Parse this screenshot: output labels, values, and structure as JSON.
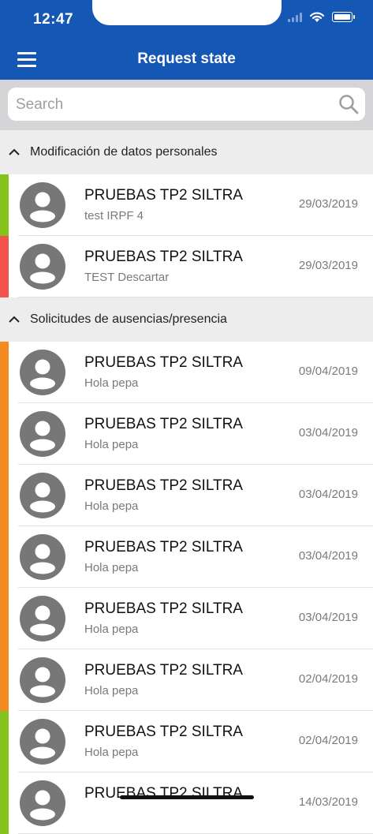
{
  "status_bar": {
    "time": "12:47"
  },
  "header": {
    "title": "Request state"
  },
  "search": {
    "placeholder": "Search"
  },
  "colors": {
    "header": "#1557b5",
    "green": "#85c31c",
    "red": "#f4524a",
    "orange": "#f38b22"
  },
  "sections": [
    {
      "title": "Modificación de datos personales",
      "items": [
        {
          "name": "PRUEBAS TP2 SILTRA",
          "subtitle": "test IRPF 4",
          "date": "29/03/2019",
          "status": "green"
        },
        {
          "name": "PRUEBAS TP2 SILTRA",
          "subtitle": "TEST Descartar",
          "date": "29/03/2019",
          "status": "red"
        }
      ]
    },
    {
      "title": "Solicitudes de ausencias/presencia",
      "items": [
        {
          "name": "PRUEBAS TP2 SILTRA",
          "subtitle": "Hola pepa",
          "date": "09/04/2019",
          "status": "orange"
        },
        {
          "name": "PRUEBAS TP2 SILTRA",
          "subtitle": "Hola pepa",
          "date": "03/04/2019",
          "status": "orange"
        },
        {
          "name": "PRUEBAS TP2 SILTRA",
          "subtitle": "Hola pepa",
          "date": "03/04/2019",
          "status": "orange"
        },
        {
          "name": "PRUEBAS TP2 SILTRA",
          "subtitle": "Hola pepa",
          "date": "03/04/2019",
          "status": "orange"
        },
        {
          "name": "PRUEBAS TP2 SILTRA",
          "subtitle": "Hola pepa",
          "date": "03/04/2019",
          "status": "orange"
        },
        {
          "name": "PRUEBAS TP2 SILTRA",
          "subtitle": "Hola pepa",
          "date": "02/04/2019",
          "status": "orange"
        },
        {
          "name": "PRUEBAS TP2 SILTRA",
          "subtitle": "Hola pepa",
          "date": "02/04/2019",
          "status": "green"
        },
        {
          "name": "PRUEBAS TP2 SILTRA",
          "subtitle": "",
          "date": "14/03/2019",
          "status": "green"
        }
      ]
    }
  ]
}
